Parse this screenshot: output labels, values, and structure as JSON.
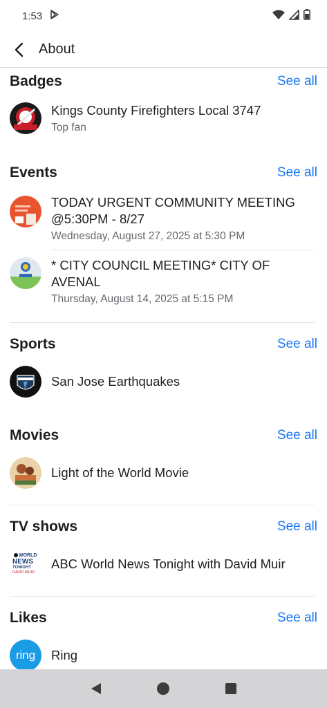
{
  "status_bar": {
    "time": "1:53"
  },
  "app_bar": {
    "title": "About"
  },
  "sections": {
    "badges": {
      "title": "Badges",
      "see_all": "See all",
      "items": [
        {
          "title": "Kings County Firefighters Local 3747",
          "subtitle": "Top fan"
        }
      ]
    },
    "events": {
      "title": "Events",
      "see_all": "See all",
      "items": [
        {
          "title_line1": "TODAY URGENT COMMUNITY MEETING",
          "title_line2": "@5:30PM -  8/27",
          "subtitle": "Wednesday, August 27, 2025 at 5:30 PM"
        },
        {
          "title_line1": "* CITY COUNCIL MEETING* CITY OF",
          "title_line2": "AVENAL",
          "subtitle": "Thursday, August 14, 2025 at 5:15 PM"
        }
      ]
    },
    "sports": {
      "title": "Sports",
      "see_all": "See all",
      "items": [
        {
          "title": "San Jose Earthquakes"
        }
      ]
    },
    "movies": {
      "title": "Movies",
      "see_all": "See all",
      "items": [
        {
          "title": "Light of the World Movie"
        }
      ]
    },
    "tv_shows": {
      "title": "TV shows",
      "see_all": "See all",
      "items": [
        {
          "title": "ABC World News Tonight with David Muir",
          "logo_text_top": "WORLD",
          "logo_text_mid": "NEWS",
          "logo_text_bot": "TONIGHT",
          "logo_text_name": "DAVID MUIR"
        }
      ]
    },
    "likes": {
      "title": "Likes",
      "see_all": "See all",
      "items": [
        {
          "title": "Ring",
          "logo_text": "ring"
        }
      ]
    }
  },
  "colors": {
    "link": "#1877f2",
    "ring_blue": "#1a9be6"
  },
  "icons": {
    "status_left": [
      "play-store-icon"
    ],
    "status_right": [
      "wifi-icon",
      "signal-icon",
      "battery-icon"
    ],
    "nav": [
      "back-triangle-icon",
      "home-circle-icon",
      "recents-square-icon"
    ]
  }
}
